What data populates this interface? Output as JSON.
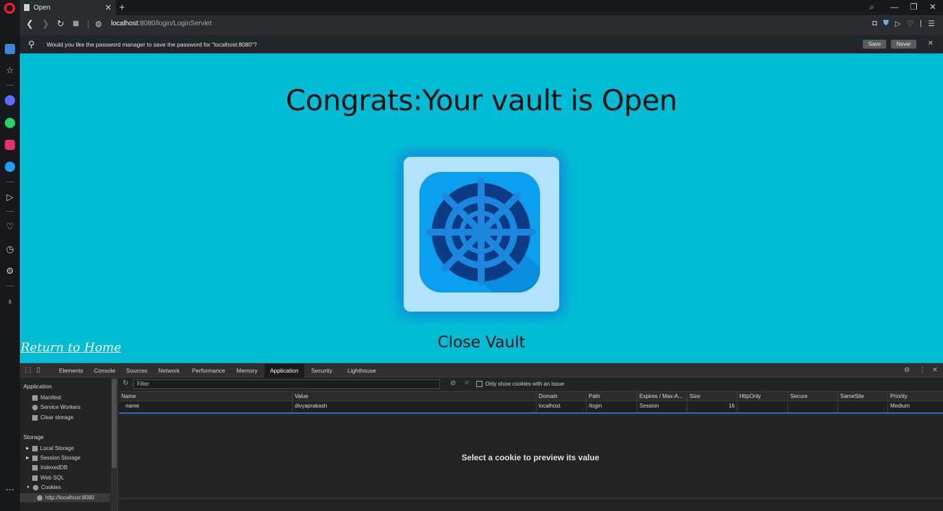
{
  "browser": {
    "tab_title": "Open",
    "new_tab": "+",
    "url_host": "localhost",
    "url_rest": ":8080/login/LoginServlet"
  },
  "password_bar": {
    "message": "Would you like the password manager to save the password for \"localhost:8080\"?",
    "save_label": "Save",
    "never_label": "Never"
  },
  "page": {
    "title": "Congrats:Your vault is Open",
    "close_label": "Close Vault",
    "return_label": "Return to Home"
  },
  "devtools": {
    "tabs": [
      "Elements",
      "Console",
      "Sources",
      "Network",
      "Performance",
      "Memory",
      "Application",
      "Security",
      "Lighthouse"
    ],
    "active_tab": "Application",
    "sidebar": {
      "application_heading": "Application",
      "manifest": "Manifest",
      "service_workers": "Service Workers",
      "clear_storage": "Clear storage",
      "storage_heading": "Storage",
      "local_storage": "Local Storage",
      "session_storage": "Session Storage",
      "indexeddb": "IndexedDB",
      "web_sql": "Web SQL",
      "cookies": "Cookies",
      "cookie_origin": "http://localhost:8080"
    },
    "filter_placeholder": "Filter",
    "only_issue_label": "Only show cookies with an issue",
    "columns": [
      "Name",
      "Value",
      "Domain",
      "Path",
      "Expires / Max-A...",
      "Size",
      "HttpOnly",
      "Secure",
      "SameSite",
      "Priority"
    ],
    "rows": [
      [
        "name",
        "divyaprakash",
        "localhost",
        "/login",
        "Session",
        "16",
        "",
        "",
        "",
        "Medium"
      ]
    ],
    "preview_text": "Select a cookie to preview its value"
  },
  "colors": {
    "page_bg": "#00bcd4",
    "vault_card": "#b3e3fb",
    "vault_outer": "#0aa0ef",
    "vault_dial": "#0b3a85",
    "vault_spokes": "#1b87de"
  }
}
